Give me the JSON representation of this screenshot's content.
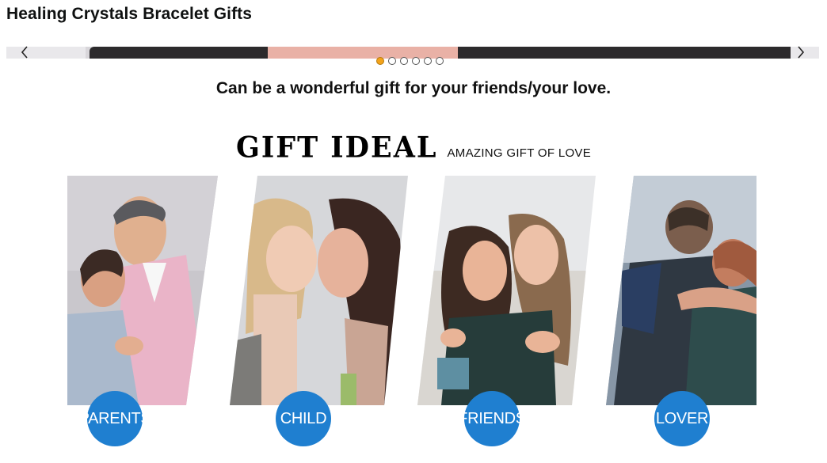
{
  "page": {
    "title": "Healing Crystals Bracelet Gifts"
  },
  "carousel": {
    "prev_icon": "chevron-left-icon",
    "next_icon": "chevron-right-icon",
    "dots_count": 6,
    "active_dot": 1
  },
  "subtitle": "Can be a wonderful gift for your friends/your love.",
  "gift_section": {
    "heading": "GIFT IDEAL",
    "tagline": "AMAZING GIFT OF LOVE",
    "categories": [
      {
        "label": "PARENTS"
      },
      {
        "label": "CHILD"
      },
      {
        "label": "FRIENDS"
      },
      {
        "label": "LOVER"
      }
    ]
  },
  "colors": {
    "badge": "#1f7fd0",
    "active_dot": "#f3a31a"
  }
}
